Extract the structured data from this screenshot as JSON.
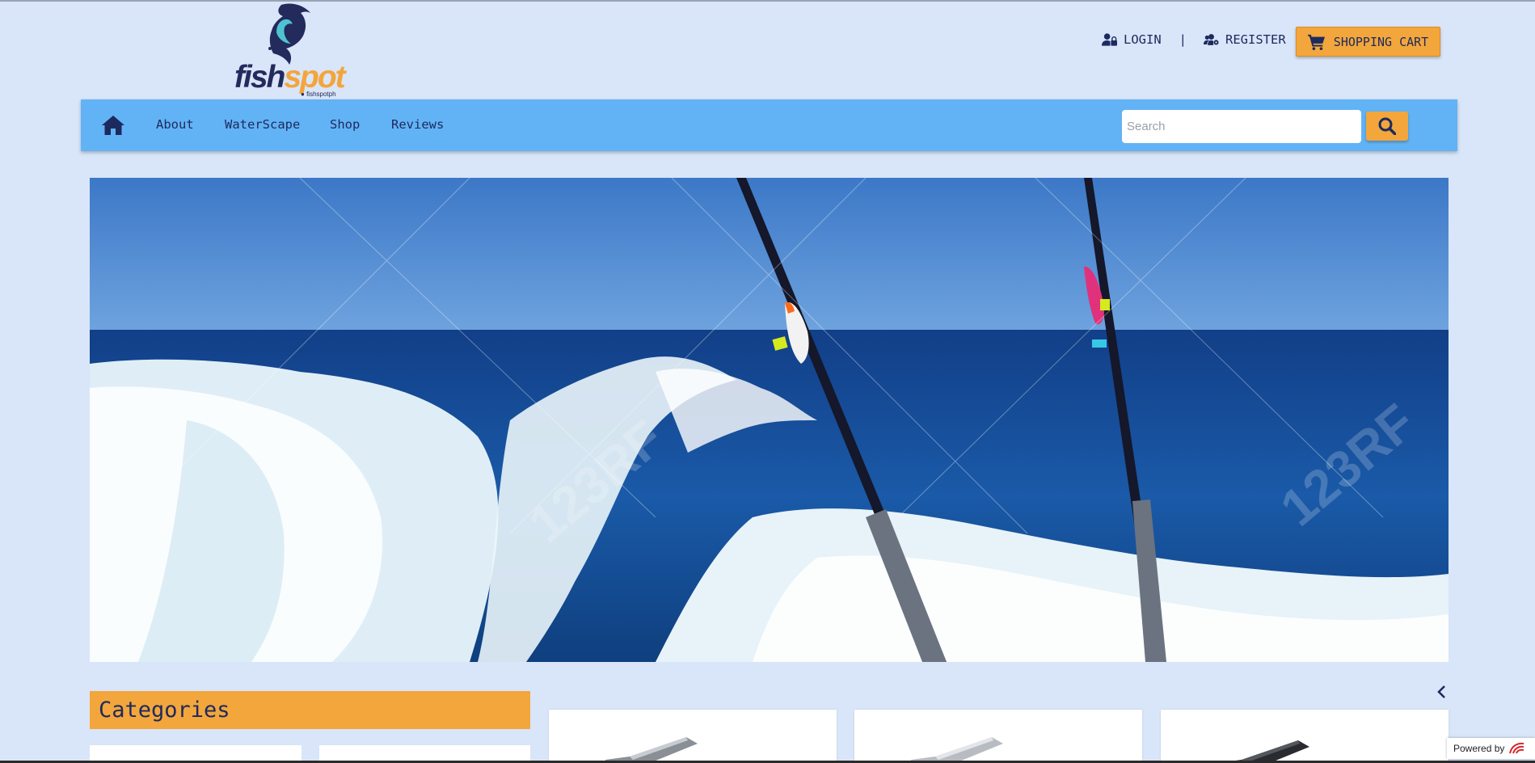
{
  "brand": {
    "logo_alt": "fishspot",
    "word_part1": "fish",
    "word_part2": "spot",
    "handle": "fishspotph",
    "colors": {
      "navy": "#232a5c",
      "orange": "#f3a53c",
      "teal": "#4ec3d3"
    }
  },
  "header": {
    "login_label": "LOGIN",
    "separator": "|",
    "register_label": "REGISTER",
    "cart_label": "SHOPPING CART",
    "icons": {
      "login": "user-lock-icon",
      "register": "users-cog-icon",
      "cart": "shopping-cart-icon"
    }
  },
  "navbar": {
    "home_icon": "home-icon",
    "items": [
      {
        "label": "About"
      },
      {
        "label": "WaterScape"
      },
      {
        "label": "Shop"
      },
      {
        "label": "Reviews"
      }
    ],
    "search": {
      "placeholder": "Search",
      "value": "",
      "button_icon": "search-icon"
    },
    "colors": {
      "bar": "#62b3f5",
      "accent": "#f3a63c"
    }
  },
  "hero": {
    "description_icon": "hero-image",
    "watermark_text": "123RF"
  },
  "categories": {
    "title": "Categories"
  },
  "products": {
    "prev_icon": "chevron-left-icon"
  },
  "footer_badge": {
    "label": "Powered by"
  }
}
